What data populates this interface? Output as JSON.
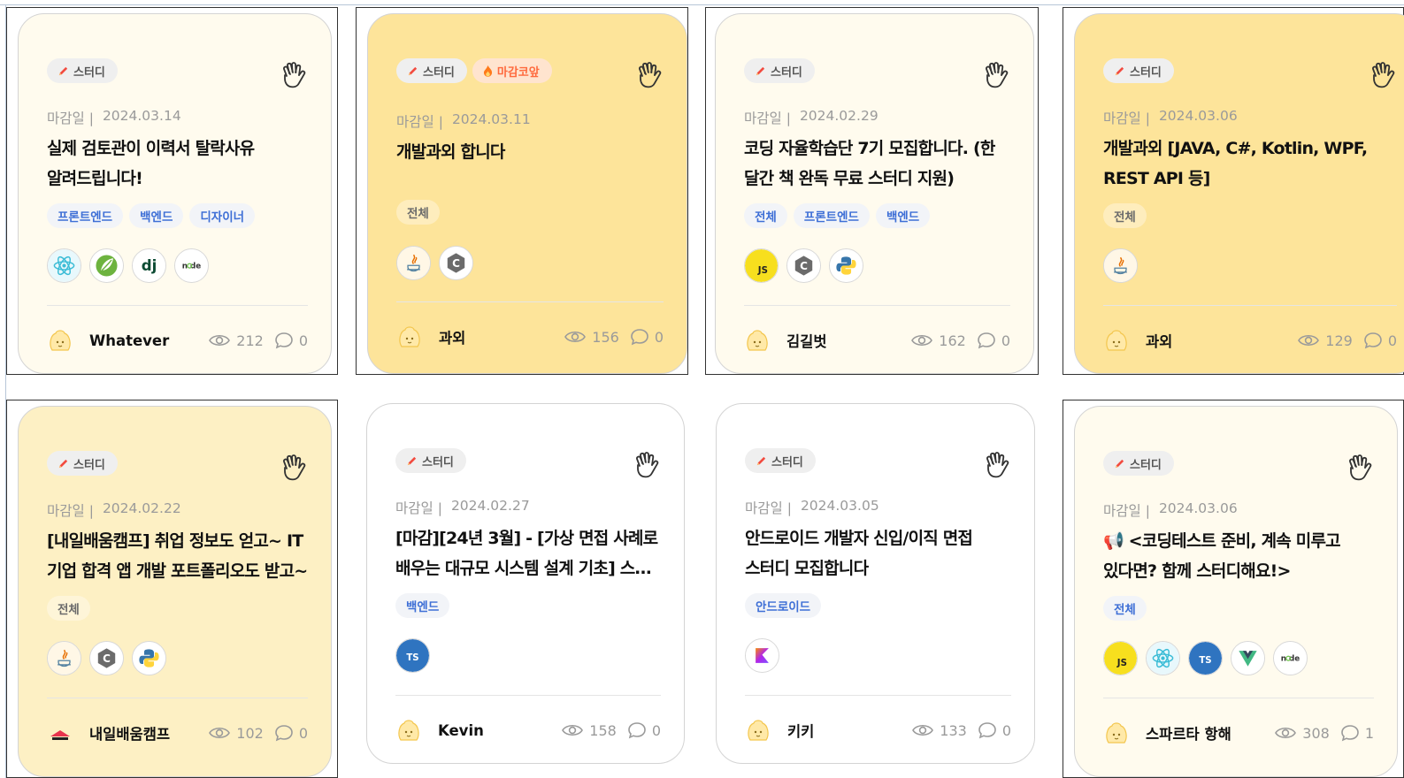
{
  "labels": {
    "deadline": "마감일 |"
  },
  "cards": [
    {
      "type": "스터디",
      "hot": "",
      "deadline": "2024.03.14",
      "title": "실제 검토관이 이력서 탈락사유 알려드립니다!",
      "positions": [
        "프론트엔드",
        "백엔드",
        "디자이너"
      ],
      "stacks": [
        "react-icon",
        "spring-icon",
        "django-icon",
        "node-icon"
      ],
      "author": "Whatever",
      "views": "212",
      "comments": "0"
    },
    {
      "type": "스터디",
      "hot": "마감코앞",
      "deadline": "2024.03.11",
      "title": "개발과외 합니다",
      "positions": [
        "전체"
      ],
      "stacks": [
        "java-icon",
        "c-icon"
      ],
      "author": "과외",
      "views": "156",
      "comments": "0"
    },
    {
      "type": "스터디",
      "hot": "",
      "deadline": "2024.02.29",
      "title": "코딩 자율학습단 7기 모집합니다. (한 달간 책 완독 무료 스터디 지원)",
      "positions": [
        "전체",
        "프론트엔드",
        "백엔드"
      ],
      "stacks": [
        "javascript-icon",
        "c-icon",
        "python-icon"
      ],
      "author": "김길벗",
      "views": "162",
      "comments": "0"
    },
    {
      "type": "스터디",
      "hot": "",
      "deadline": "2024.03.06",
      "title": "개발과외 [JAVA, C#, Kotlin, WPF, REST API 등]",
      "positions": [
        "전체"
      ],
      "stacks": [
        "java-icon"
      ],
      "author": "과외",
      "views": "129",
      "comments": "0"
    },
    {
      "type": "스터디",
      "hot": "",
      "deadline": "2024.02.22",
      "title": "[내일배움캠프] 취업 정보도 얻고~ IT 기업 합격 앱 개발 포트폴리오도 받고~",
      "positions": [
        "전체"
      ],
      "stacks": [
        "java-icon",
        "c-icon",
        "python-icon"
      ],
      "author": "내일배움캠프",
      "views": "102",
      "comments": "0"
    },
    {
      "type": "스터디",
      "hot": "",
      "deadline": "2024.02.27",
      "title": "[마감][24년 3월] - [가상 면접 사례로 배우는 대규모 시스템 설계 기초] 스…",
      "positions": [
        "백엔드"
      ],
      "stacks": [
        "typescript-icon"
      ],
      "author": "Kevin",
      "views": "158",
      "comments": "0"
    },
    {
      "type": "스터디",
      "hot": "",
      "deadline": "2024.03.05",
      "title": "안드로이드 개발자 신입/이직 면접 스터디 모집합니다",
      "positions": [
        "안드로이드"
      ],
      "stacks": [
        "kotlin-icon"
      ],
      "author": "키키",
      "views": "133",
      "comments": "0"
    },
    {
      "type": "스터디",
      "hot": "",
      "deadline": "2024.03.06",
      "title": "📢 <코딩테스트 준비, 계속 미루고 있다면? 함께 스터디해요!>",
      "positions": [
        "전체"
      ],
      "stacks": [
        "javascript-icon",
        "react-icon",
        "typescript-icon",
        "vue-icon",
        "node-icon"
      ],
      "author": "스파르타 항해",
      "views": "308",
      "comments": "1"
    }
  ]
}
